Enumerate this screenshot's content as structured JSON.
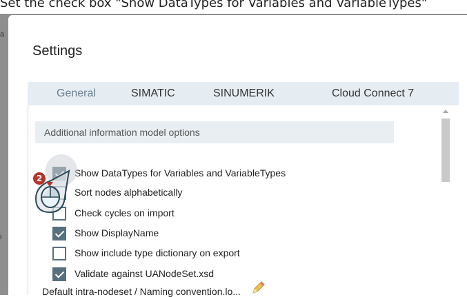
{
  "instruction": "Set the check box \"Show DataTypes for Variables and VariableTypes\"",
  "backdrop_peek": [
    "a",
    "i"
  ],
  "dialog": {
    "title": "Settings",
    "tabs": [
      {
        "label": "General",
        "active": true
      },
      {
        "label": "SIMATIC",
        "active": false
      },
      {
        "label": "SINUMERIK",
        "active": false
      },
      {
        "label": "Cloud Connect 7",
        "active": false
      }
    ],
    "section_header": "Additional information model options",
    "options": [
      {
        "label": "Show DataTypes for Variables and VariableTypes",
        "checked": true
      },
      {
        "label": "Sort nodes alphabetically",
        "checked": false
      },
      {
        "label": "Check cycles on import",
        "checked": false
      },
      {
        "label": "Show DisplayName",
        "checked": true
      },
      {
        "label": "Show include type dictionary on export",
        "checked": false
      },
      {
        "label": "Validate against UANodeSet.xsd",
        "checked": true
      }
    ],
    "partial_text": "Default intra-nodeset / Naming convention.lo..."
  },
  "callout": {
    "step_number": "2"
  },
  "colors": {
    "checkbox": "#56707f",
    "badge": "#b5332a",
    "tabbar": "#e6edf2"
  },
  "icons": [
    "pencil-icon",
    "mouse-click-icon",
    "scroll-up-icon"
  ]
}
